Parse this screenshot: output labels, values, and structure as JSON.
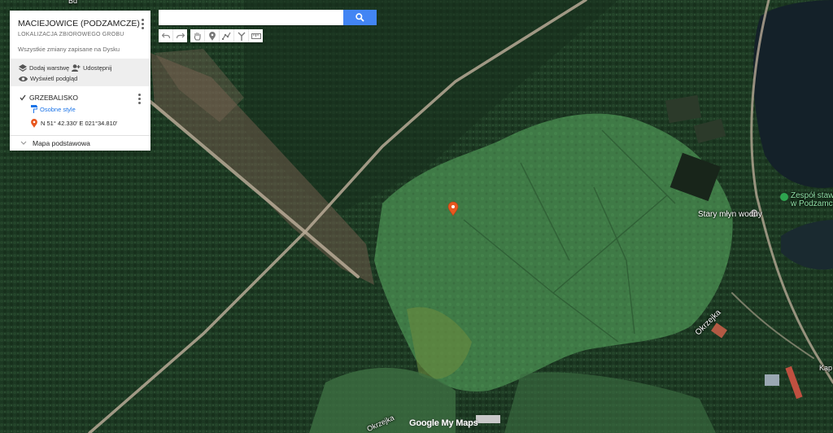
{
  "map": {
    "labels": {
      "okrzejka": "Okrzejka",
      "stary_mlyn": "Stary młyn wodny",
      "zespol_1": "Zespół stawów",
      "zespol_2": "w Podzamczu",
      "bottom_road": "Okrzejka",
      "kap": "Kap",
      "bd": "Bd"
    },
    "logo_text": "Google My Maps"
  },
  "panel": {
    "title": "MACIEJOWICE (PODZAMCZE)",
    "subtitle": "LOKALIZACJA ZBIOROWEGO GROBU",
    "saved_status": "Wszystkie zmiany zapisane na Dysku",
    "actions": {
      "add_layer": "Dodaj warstwę",
      "share": "Udostępnij",
      "preview": "Wyświetl podgląd"
    },
    "layer": {
      "name": "GRZEBALISKO",
      "style_link": "Osobne style",
      "place": "N 51° 42.330' E 021°34.810'"
    },
    "base_map": "Mapa podstawowa"
  },
  "search": {
    "value": "",
    "placeholder": ""
  },
  "toolbar": {
    "icons": [
      "undo-icon",
      "redo-icon",
      "hand-icon",
      "marker-icon",
      "draw-line-icon",
      "directions-icon",
      "measure-icon"
    ]
  },
  "colors": {
    "marker": "#e8571f",
    "search_button": "#4285f4",
    "link": "#1a73e8"
  }
}
